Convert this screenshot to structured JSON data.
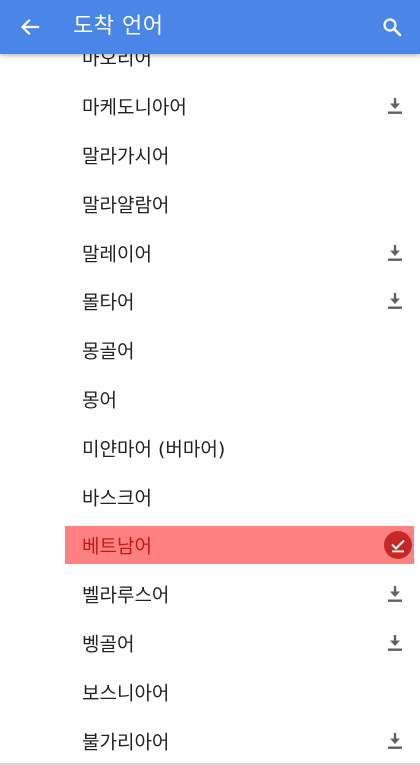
{
  "appbar": {
    "title": "도착 언어"
  },
  "colors": {
    "appbar": "#4a86e8",
    "highlight": "#ff8080",
    "selected_text": "#c41a1a",
    "check_badge": "#c62828"
  },
  "languages": [
    {
      "label": "마오리어",
      "downloadable": false
    },
    {
      "label": "마케도니아어",
      "downloadable": true
    },
    {
      "label": "말라가시어",
      "downloadable": false
    },
    {
      "label": "말라얄람어",
      "downloadable": false
    },
    {
      "label": "말레이어",
      "downloadable": true
    },
    {
      "label": "몰타어",
      "downloadable": true
    },
    {
      "label": "몽골어",
      "downloadable": false
    },
    {
      "label": "몽어",
      "downloadable": false
    },
    {
      "label": "미얀마어 (버마어)",
      "downloadable": false
    },
    {
      "label": "바스크어",
      "downloadable": false
    },
    {
      "label": "베트남어",
      "downloadable": false,
      "selected": true
    },
    {
      "label": "벨라루스어",
      "downloadable": true
    },
    {
      "label": "벵골어",
      "downloadable": true
    },
    {
      "label": "보스니아어",
      "downloadable": false
    },
    {
      "label": "불가리아어",
      "downloadable": true
    }
  ]
}
